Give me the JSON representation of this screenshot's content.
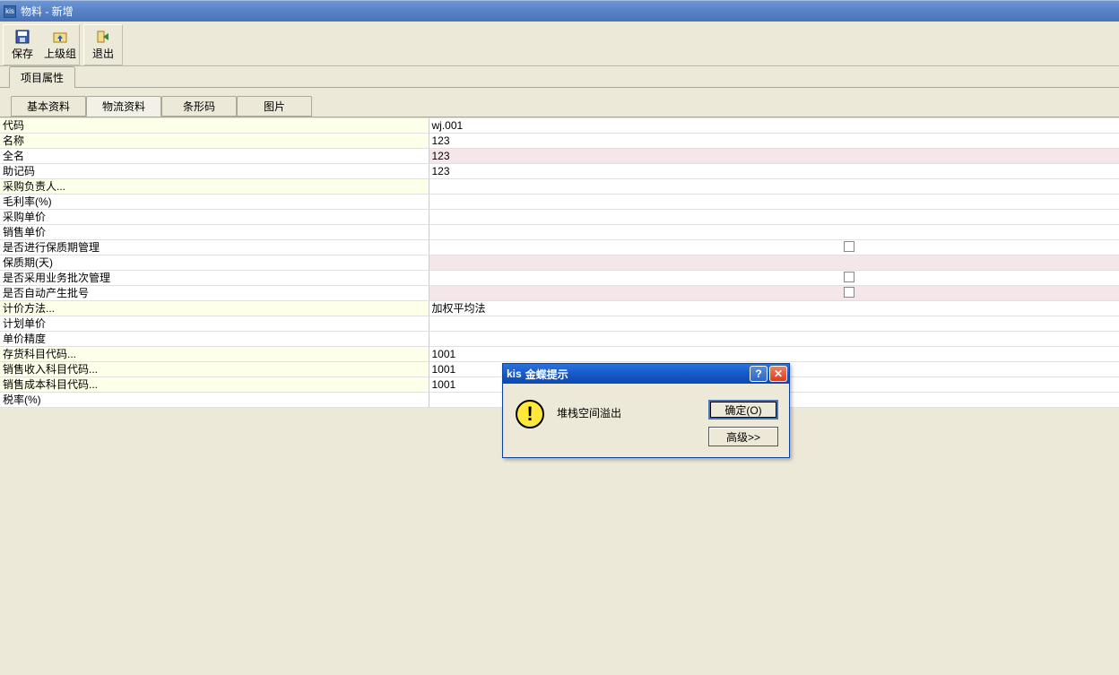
{
  "window": {
    "icon_label": "kis",
    "title": "物料  -  新增"
  },
  "toolbar": {
    "save": "保存",
    "parent_group": "上级组",
    "exit": "退出"
  },
  "section_tab": {
    "project_attr": "项目属性"
  },
  "tabs": {
    "basic": "基本资料",
    "logistics": "物流资料",
    "barcode": "条形码",
    "image": "图片"
  },
  "rows": [
    {
      "label": "代码",
      "value": "wj.001",
      "yellow": true,
      "pink": false,
      "chk": false
    },
    {
      "label": "名称",
      "value": "123",
      "yellow": true,
      "pink": false,
      "chk": false
    },
    {
      "label": "全名",
      "value": "123",
      "yellow": false,
      "pink": true,
      "chk": false
    },
    {
      "label": "助记码",
      "value": "123",
      "yellow": false,
      "pink": false,
      "chk": false
    },
    {
      "label": "采购负责人...",
      "value": "",
      "yellow": true,
      "pink": false,
      "chk": false
    },
    {
      "label": "毛利率(%)",
      "value": "",
      "yellow": false,
      "pink": false,
      "chk": false
    },
    {
      "label": "采购单价",
      "value": "",
      "yellow": false,
      "pink": false,
      "chk": false
    },
    {
      "label": "销售单价",
      "value": "",
      "yellow": false,
      "pink": false,
      "chk": false
    },
    {
      "label": "是否进行保质期管理",
      "value": "",
      "yellow": false,
      "pink": false,
      "chk": true
    },
    {
      "label": "保质期(天)",
      "value": "",
      "yellow": false,
      "pink": true,
      "chk": false
    },
    {
      "label": "是否采用业务批次管理",
      "value": "",
      "yellow": false,
      "pink": false,
      "chk": true
    },
    {
      "label": "是否自动产生批号",
      "value": "",
      "yellow": false,
      "pink": true,
      "chk": true
    },
    {
      "label": "计价方法...",
      "value": "加权平均法",
      "yellow": true,
      "pink": false,
      "chk": false
    },
    {
      "label": "计划单价",
      "value": "",
      "yellow": false,
      "pink": false,
      "chk": false
    },
    {
      "label": "单价精度",
      "value": "",
      "yellow": false,
      "pink": false,
      "chk": false
    },
    {
      "label": "存货科目代码...",
      "value": "1001",
      "yellow": true,
      "pink": false,
      "chk": false
    },
    {
      "label": "销售收入科目代码...",
      "value": "1001",
      "yellow": true,
      "pink": false,
      "chk": false
    },
    {
      "label": "销售成本科目代码...",
      "value": "1001",
      "yellow": true,
      "pink": false,
      "chk": false
    },
    {
      "label": "税率(%)",
      "value": "",
      "yellow": false,
      "pink": false,
      "chk": false
    }
  ],
  "dialog": {
    "icon_label": "kis",
    "title": "金蝶提示",
    "message": "堆栈空间溢出",
    "ok": "确定(O)",
    "advanced": "高级>>",
    "help": "?",
    "close": "✕"
  }
}
